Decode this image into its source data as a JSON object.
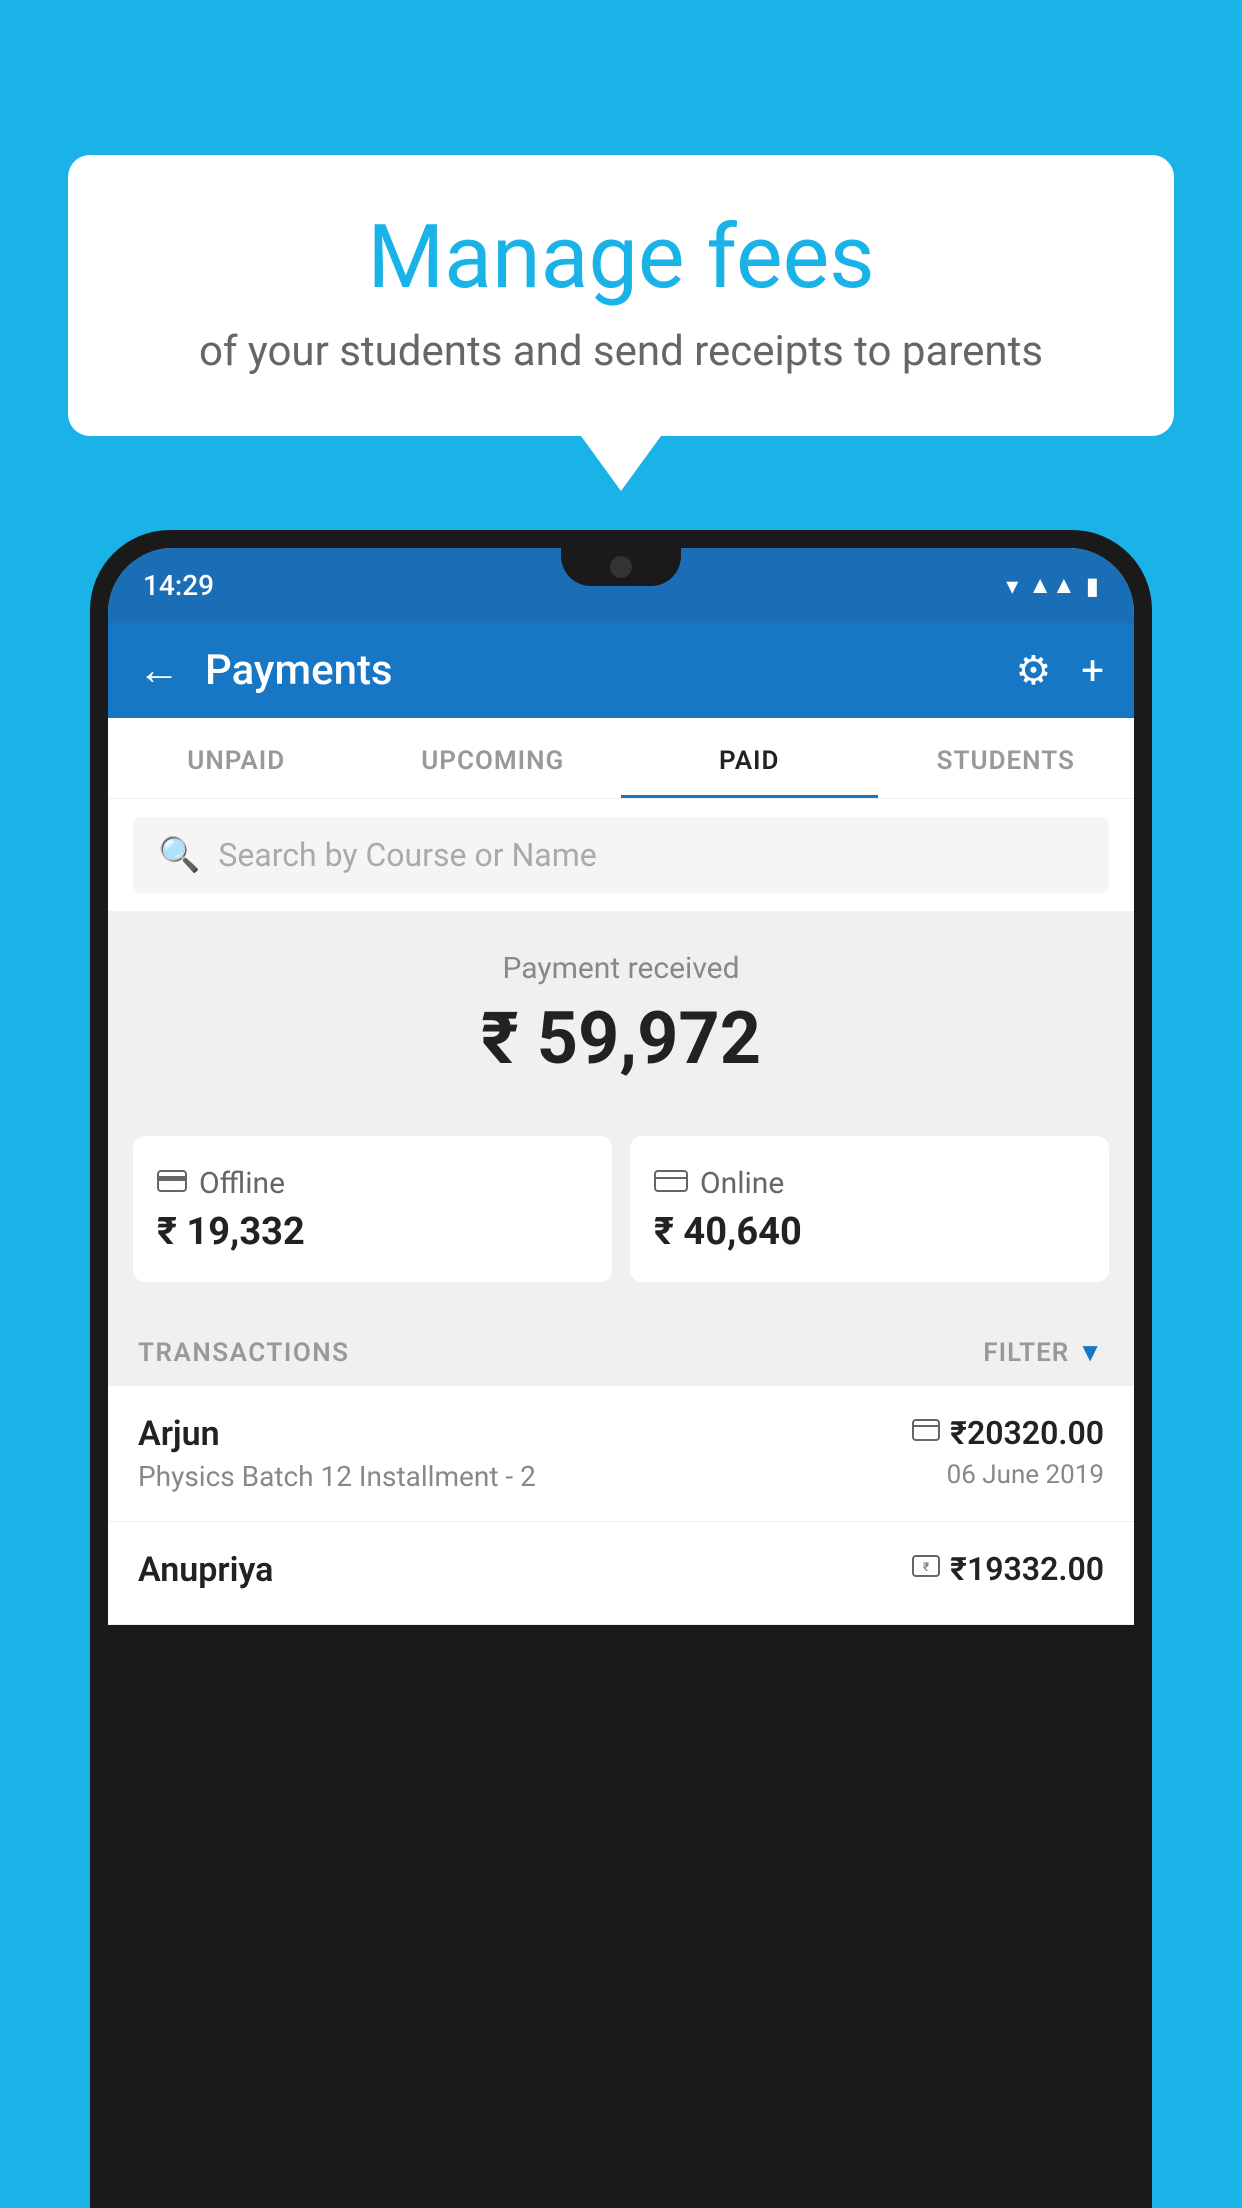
{
  "background_color": "#1ab3e8",
  "speech_bubble": {
    "title": "Manage fees",
    "subtitle": "of your students and send receipts to parents"
  },
  "phone": {
    "status_bar": {
      "time": "14:29"
    },
    "header": {
      "title": "Payments",
      "back_label": "←",
      "settings_label": "⚙",
      "add_label": "+"
    },
    "tabs": [
      {
        "label": "UNPAID",
        "active": false
      },
      {
        "label": "UPCOMING",
        "active": false
      },
      {
        "label": "PAID",
        "active": true
      },
      {
        "label": "STUDENTS",
        "active": false
      }
    ],
    "search": {
      "placeholder": "Search by Course or Name"
    },
    "payment_received": {
      "label": "Payment received",
      "amount": "₹ 59,972"
    },
    "cards": [
      {
        "icon": "💳",
        "label": "Offline",
        "amount": "₹ 19,332"
      },
      {
        "icon": "💳",
        "label": "Online",
        "amount": "₹ 40,640"
      }
    ],
    "transactions_label": "TRANSACTIONS",
    "filter_label": "FILTER",
    "transactions": [
      {
        "name": "Arjun",
        "course": "Physics Batch 12 Installment - 2",
        "amount": "₹20320.00",
        "date": "06 June 2019",
        "method_icon": "💳"
      },
      {
        "name": "Anupriya",
        "course": "",
        "amount": "₹19332.00",
        "date": "",
        "method_icon": "💴"
      }
    ]
  }
}
